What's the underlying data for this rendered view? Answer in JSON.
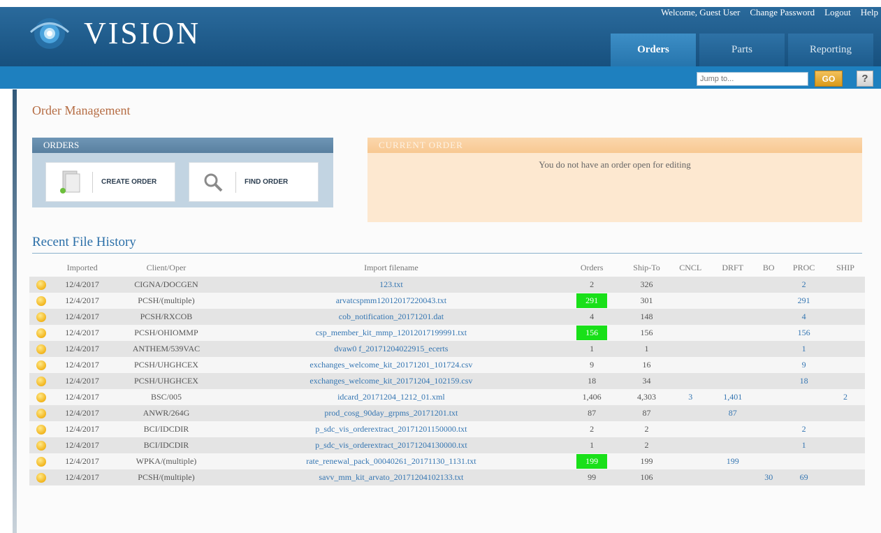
{
  "header": {
    "logo_text": "VISION",
    "links": [
      "Welcome, Guest User",
      "Change Password",
      "Logout",
      "Help"
    ],
    "tabs": [
      {
        "label": "Orders",
        "active": true
      },
      {
        "label": "Parts",
        "active": false
      },
      {
        "label": "Reporting",
        "active": false
      }
    ],
    "jump_placeholder": "Jump to...",
    "go_label": "GO",
    "help_label": "?"
  },
  "page_title": "Order Management",
  "orders_panel": {
    "title": "ORDERS",
    "create_label": "CREATE ORDER",
    "find_label": "FIND ORDER"
  },
  "current_order": {
    "title": "CURRENT ORDER",
    "message": "You do not have an order open for editing"
  },
  "recent_history": {
    "title": "Recent File History",
    "columns": [
      "",
      "Imported",
      "Client/Oper",
      "Import filename",
      "Orders",
      "Ship-To",
      "CNCL",
      "DRFT",
      "BO",
      "PROC",
      "SHIP"
    ],
    "rows": [
      {
        "imported": "12/4/2017",
        "client": "CIGNA/DOCGEN",
        "filename": "123.txt",
        "orders": "2",
        "ship_to": "326",
        "cncl": "",
        "drft": "",
        "bo": "",
        "proc": "2",
        "ship": "",
        "highlight": false
      },
      {
        "imported": "12/4/2017",
        "client": "PCSH/(multiple)",
        "filename": "arvatcspmm12012017220043.txt",
        "orders": "291",
        "ship_to": "301",
        "cncl": "",
        "drft": "",
        "bo": "",
        "proc": "291",
        "ship": "",
        "highlight": true
      },
      {
        "imported": "12/4/2017",
        "client": "PCSH/RXCOB",
        "filename": "cob_notification_20171201.dat",
        "orders": "4",
        "ship_to": "148",
        "cncl": "",
        "drft": "",
        "bo": "",
        "proc": "4",
        "ship": "",
        "highlight": false
      },
      {
        "imported": "12/4/2017",
        "client": "PCSH/OHIOMMP",
        "filename": "csp_member_kit_mmp_12012017199991.txt",
        "orders": "156",
        "ship_to": "156",
        "cncl": "",
        "drft": "",
        "bo": "",
        "proc": "156",
        "ship": "",
        "highlight": true
      },
      {
        "imported": "12/4/2017",
        "client": "ANTHEM/539VAC",
        "filename": "dvaw0 f_20171204022915_ecerts",
        "orders": "1",
        "ship_to": "1",
        "cncl": "",
        "drft": "",
        "bo": "",
        "proc": "1",
        "ship": "",
        "highlight": false
      },
      {
        "imported": "12/4/2017",
        "client": "PCSH/UHGHCEX",
        "filename": "exchanges_welcome_kit_20171201_101724.csv",
        "orders": "9",
        "ship_to": "16",
        "cncl": "",
        "drft": "",
        "bo": "",
        "proc": "9",
        "ship": "",
        "highlight": false
      },
      {
        "imported": "12/4/2017",
        "client": "PCSH/UHGHCEX",
        "filename": "exchanges_welcome_kit_20171204_102159.csv",
        "orders": "18",
        "ship_to": "34",
        "cncl": "",
        "drft": "",
        "bo": "",
        "proc": "18",
        "ship": "",
        "highlight": false
      },
      {
        "imported": "12/4/2017",
        "client": "BSC/005",
        "filename": "idcard_20171204_1212_01.xml",
        "orders": "1,406",
        "ship_to": "4,303",
        "cncl": "3",
        "drft": "1,401",
        "bo": "",
        "proc": "",
        "ship": "2",
        "highlight": false
      },
      {
        "imported": "12/4/2017",
        "client": "ANWR/264G",
        "filename": "prod_cosg_90day_grpms_20171201.txt",
        "orders": "87",
        "ship_to": "87",
        "cncl": "",
        "drft": "87",
        "bo": "",
        "proc": "",
        "ship": "",
        "highlight": false
      },
      {
        "imported": "12/4/2017",
        "client": "BCI/IDCDIR",
        "filename": "p_sdc_vis_orderextract_20171201150000.txt",
        "orders": "2",
        "ship_to": "2",
        "cncl": "",
        "drft": "",
        "bo": "",
        "proc": "2",
        "ship": "",
        "highlight": false
      },
      {
        "imported": "12/4/2017",
        "client": "BCI/IDCDIR",
        "filename": "p_sdc_vis_orderextract_20171204130000.txt",
        "orders": "1",
        "ship_to": "2",
        "cncl": "",
        "drft": "",
        "bo": "",
        "proc": "1",
        "ship": "",
        "highlight": false
      },
      {
        "imported": "12/4/2017",
        "client": "WPKA/(multiple)",
        "filename": "rate_renewal_pack_00040261_20171130_1131.txt",
        "orders": "199",
        "ship_to": "199",
        "cncl": "",
        "drft": "199",
        "bo": "",
        "proc": "",
        "ship": "",
        "highlight": true
      },
      {
        "imported": "12/4/2017",
        "client": "PCSH/(multiple)",
        "filename": "savv_mm_kit_arvato_20171204102133.txt",
        "orders": "99",
        "ship_to": "106",
        "cncl": "",
        "drft": "",
        "bo": "30",
        "proc": "69",
        "ship": "",
        "highlight": false
      }
    ]
  },
  "colors": {
    "header_bg": "#1e5c8c",
    "subbar_bg": "#1e80bf",
    "highlight_green": "#19e019",
    "title_orange": "#b56c43",
    "link_blue": "#3576b2"
  }
}
